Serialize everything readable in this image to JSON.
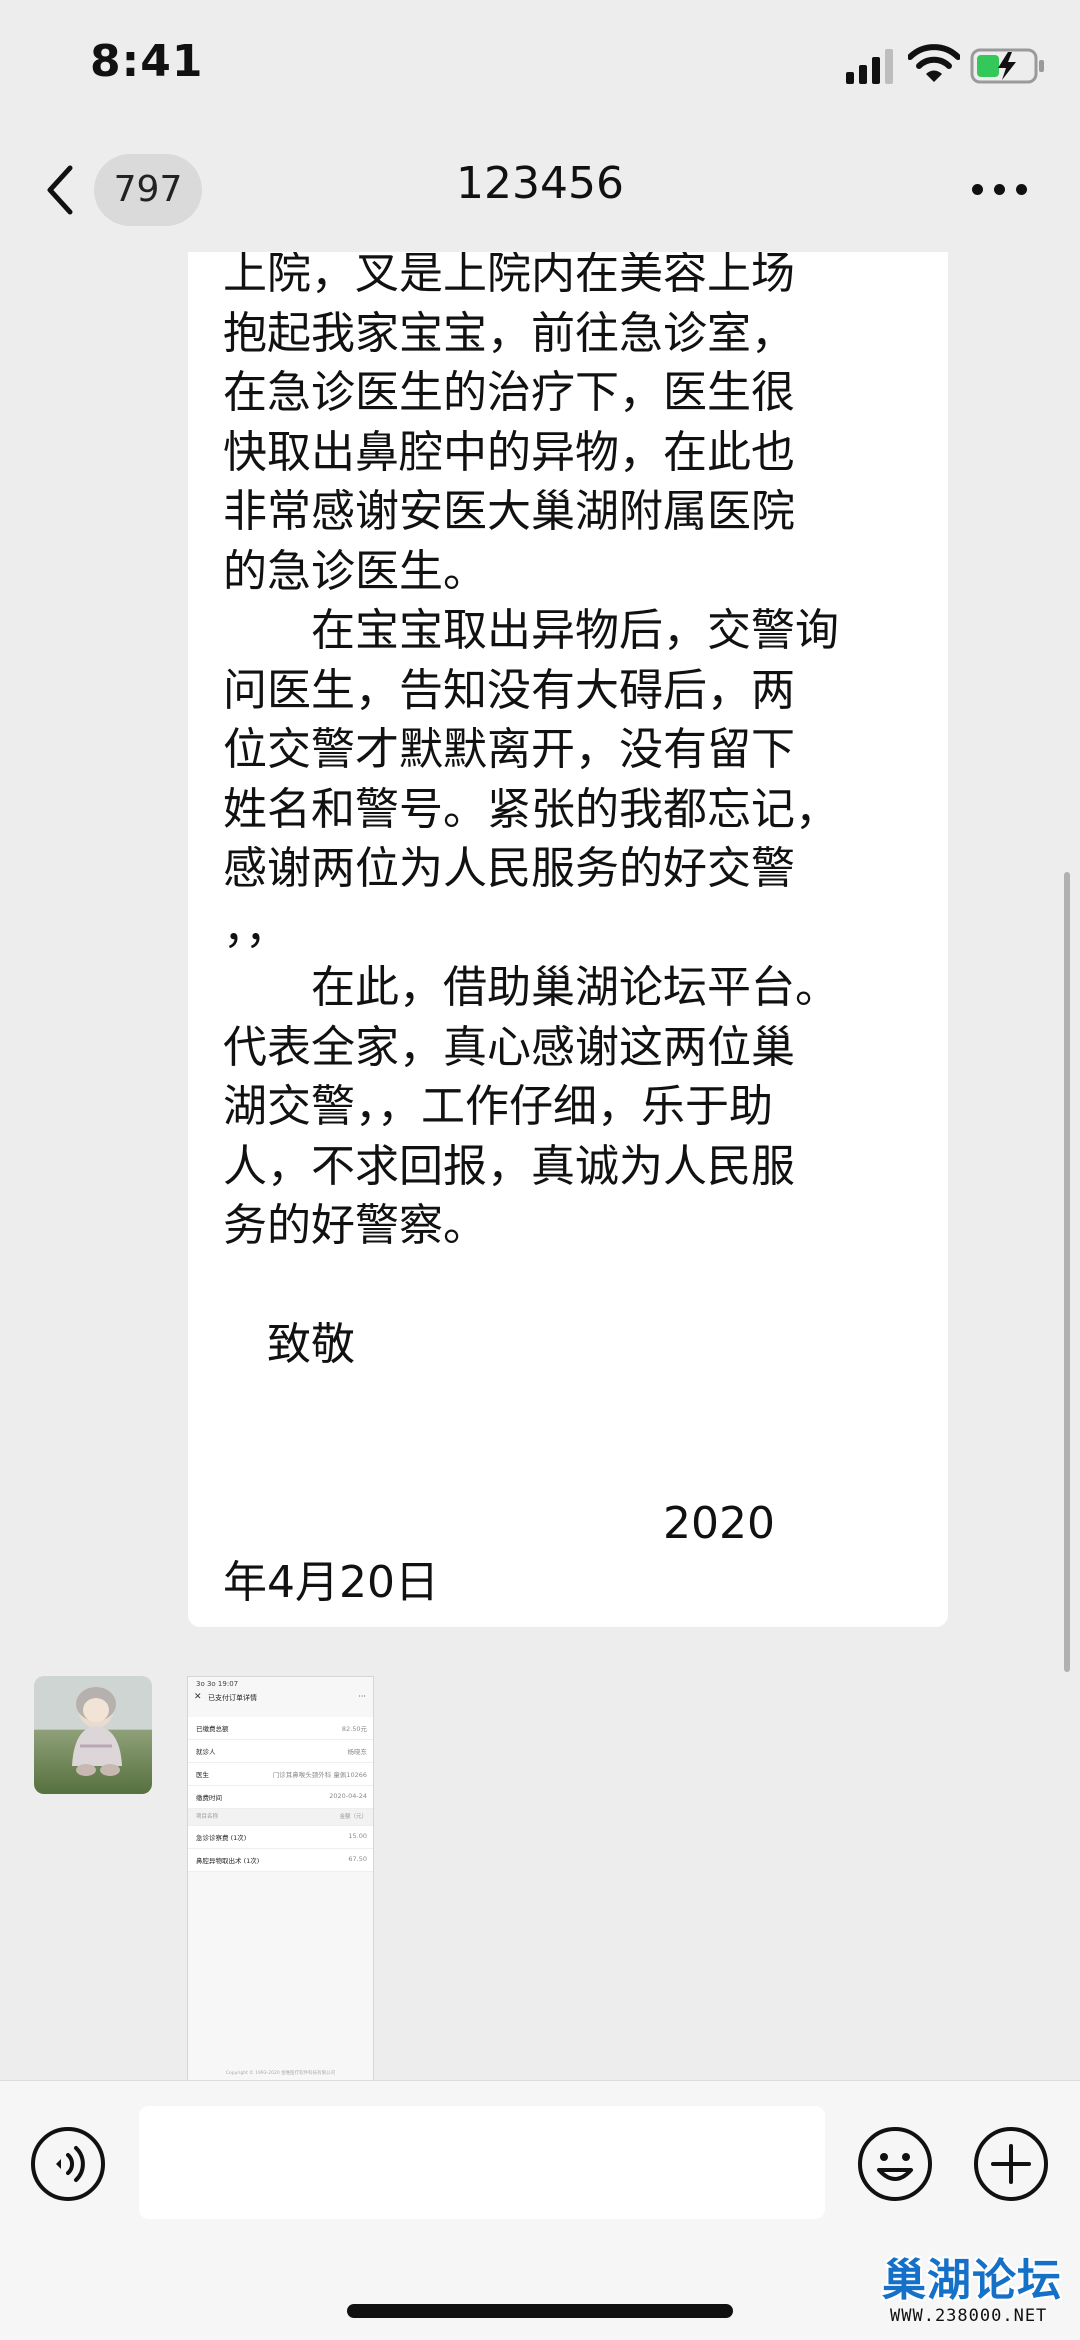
{
  "status_bar": {
    "time": "8:41",
    "icons": [
      "signal-icon",
      "wifi-icon",
      "battery-charging-icon"
    ]
  },
  "nav": {
    "back_icon": "chevron-left-icon",
    "unread_count": "797",
    "title": "123456",
    "more_icon": "more-dots-icon"
  },
  "chat": {
    "text_message": "上院，叉是上院内在美容上场\n抱起我家宝宝，前往急诊室，\n在急诊医生的治疗下，医生很\n快取出鼻腔中的异物，在此也\n非常感谢安医大巢湖附属医院\n的急诊医生。\n　　在宝宝取出异物后，交警询\n问医生，告知没有大碍后，两\n位交警才默默离开，没有留下\n姓名和警号。紧张的我都忘记，\n感谢两位为人民服务的好交警\n，，\n　　在此，借助巢湖论坛平台。\n代表全家，真心感谢这两位巢\n湖交警，，工作仔细，乐于助\n人，不求回报，真诚为人民服\n务的好警察。\n\n　致敬\n\n\n　　　　　　　　　　2020\n年4月20日",
    "image_message": {
      "status_time": "3o 3o 19:07",
      "title": "已支付订单详情",
      "rows": [
        {
          "label": "已缴费总额",
          "value": "82.50元"
        },
        {
          "label": "就诊人",
          "value": "杨晓东"
        },
        {
          "label": "医生",
          "value": "门诊耳鼻喉头颈外科 童佩10266"
        },
        {
          "label": "缴费时间",
          "value": "2020-04-24"
        }
      ],
      "items_header": {
        "label": "项目名称",
        "value": "金额（元）"
      },
      "items": [
        {
          "label": "急诊诊察费 (1次)",
          "value": "15.00"
        },
        {
          "label": "鼻腔异物取出术 (1次)",
          "value": "67.50"
        }
      ],
      "footer": "Copyright © 1993-2020 金唯医疗软件科技有限公司"
    }
  },
  "input_bar": {
    "voice_icon": "voice-icon",
    "input_value": "",
    "emoji_icon": "emoji-icon",
    "add_icon": "plus-icon"
  },
  "watermark": {
    "logo": "巢湖论坛",
    "url": "WWW.238000.NET"
  },
  "colors": {
    "background": "#EDEDED",
    "bubble": "#FFFFFF",
    "watermark_blue": "#1570C8"
  }
}
